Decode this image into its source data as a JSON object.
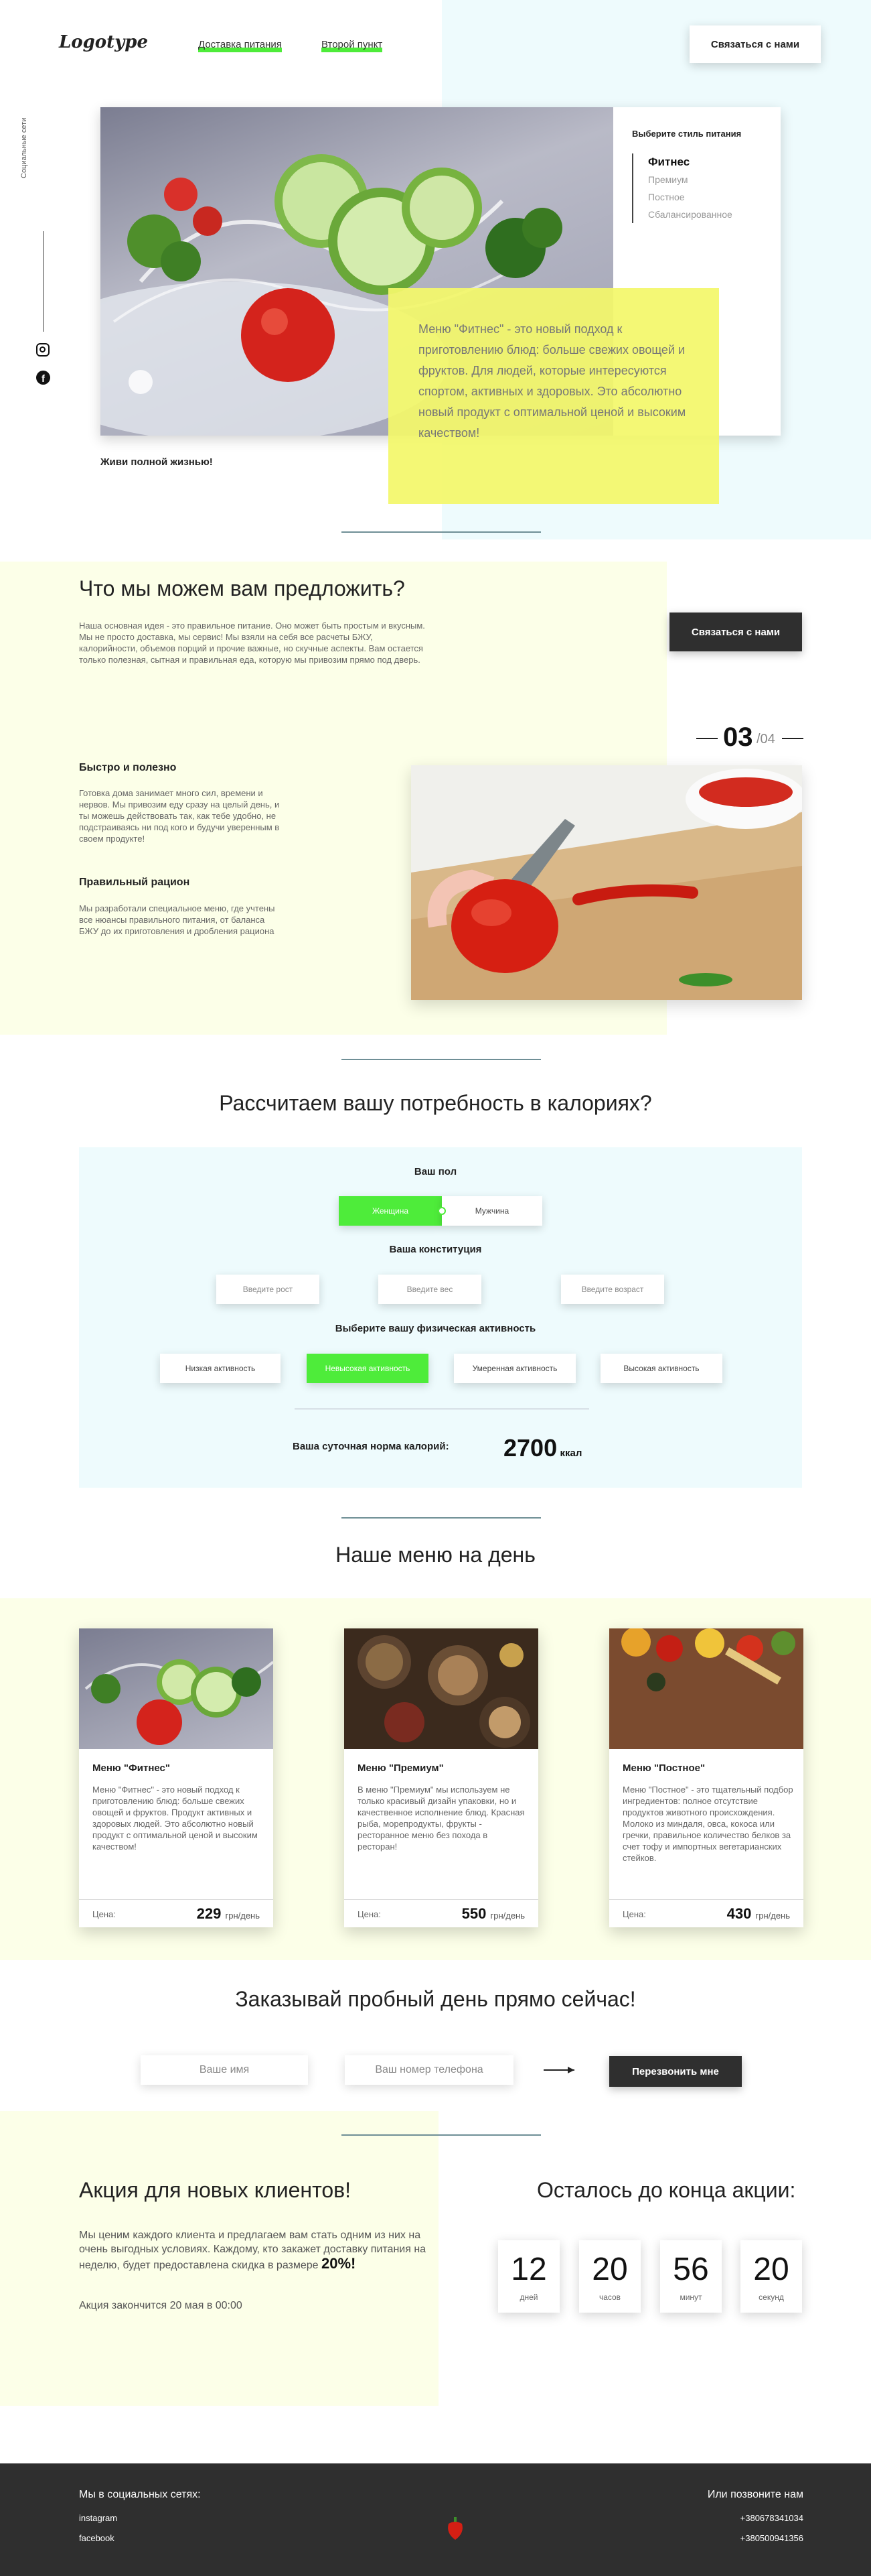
{
  "header": {
    "logo": "Logotype",
    "nav": [
      "Доставка питания",
      "Второй пункт"
    ],
    "contact_button": "Связаться с нами",
    "social_label": "Социальные сети"
  },
  "hero": {
    "style_title": "Выберите стиль питания",
    "styles": [
      "Фитнес",
      "Премиум",
      "Постное",
      "Сбалансированное"
    ],
    "active_style": "Фитнес",
    "description": "Меню \"Фитнес\" - это новый подход к приготовлению блюд: больше свежих овощей и фруктов. Для людей, которые интересуются спортом, активных и здоровых. Это абсолютно новый продукт с оптимальной ценой и высоким качеством!",
    "tagline": "Живи полной жизнью!"
  },
  "offer": {
    "title": "Что мы можем вам предложить?",
    "intro": "Наша основная идея - это правильное питание. Оно может быть простым и вкусным. Мы не просто доставка, мы сервис! Мы взяли на себя все расчеты БЖУ, калорийности, объемов порций и прочие важные, но скучные аспекты. Вам остается только полезная, сытная и правильная еда, которую мы привозим прямо под дверь.",
    "contact_button": "Связаться с нами",
    "slide_current": "03",
    "slide_total": "/04",
    "feature1_title": "Быстро и полезно",
    "feature1_text": "Готовка дома занимает много сил, времени и нервов. Мы привозим еду сразу на целый день, и ты можешь действовать так, как тебе удобно, не подстраиваясь ни под кого и будучи уверенным в своем продукте!",
    "feature2_title": "Правильный рацион",
    "feature2_text": "Мы разработали специальное меню, где учтены все нюансы правильного питания, от баланса БЖУ до их приготовления и дробления рациона"
  },
  "calculator": {
    "title": "Рассчитаем вашу потребность в калориях?",
    "gender_label": "Ваш пол",
    "gender_options": [
      "Женщина",
      "Мужчина"
    ],
    "gender_selected": "Женщина",
    "constitution_label": "Ваша конституция",
    "placeholders": {
      "height": "Введите рост",
      "weight": "Введите вес",
      "age": "Введите возраст"
    },
    "activity_label": "Выберите вашу физическая активность",
    "activity_options": [
      "Низкая активность",
      "Невысокая активность",
      "Умеренная активность",
      "Высокая активность"
    ],
    "activity_selected": "Невысокая активность",
    "result_label": "Ваша суточная норма калорий:",
    "result_value": "2700",
    "result_unit": "ккал"
  },
  "menu": {
    "title": "Наше меню на день",
    "cards": [
      {
        "title": "Меню \"Фитнес\"",
        "desc": "Меню \"Фитнес\" - это новый подход к приготовлению блюд: больше свежих овощей и фруктов. Продукт активных и здоровых людей. Это абсолютно новый продукт с оптимальной ценой и высоким качеством!",
        "price_label": "Цена:",
        "price": "229",
        "unit": "грн/день"
      },
      {
        "title": "Меню \"Премиум\"",
        "desc": "В меню \"Премиум\" мы используем не только красивый дизайн упаковки, но и качественное исполнение блюд. Красная рыба, морепродукты, фрукты - ресторанное меню без похода в ресторан!",
        "price_label": "Цена:",
        "price": "550",
        "unit": "грн/день"
      },
      {
        "title": "Меню \"Постное\"",
        "desc": "Меню \"Постное\" - это тщательный подбор ингредиентов: полное отсутствие продуктов животного происхождения. Молоко из миндаля, овса, кокоса или гречки, правильное количество белков за счет тофу и импортных вегетарианских стейков.",
        "price_label": "Цена:",
        "price": "430",
        "unit": "грн/день"
      }
    ]
  },
  "order": {
    "title": "Заказывай пробный день прямо сейчас!",
    "name_placeholder": "Ваше имя",
    "phone_placeholder": "Ваш номер телефона",
    "button": "Перезвонить мне"
  },
  "promo": {
    "title": "Акция для новых клиентов!",
    "text_before": "Мы ценим каждого клиента и предлагаем вам стать одним из них на очень выгодных условиях. Каждому, кто закажет доставку питания на неделю, будет предоставлена скидка в размере ",
    "discount": "20%!",
    "end_text": "Акция закончится 20 мая в 00:00",
    "timer_title": "Осталось до конца акции:",
    "timer": [
      {
        "value": "12",
        "label": "дней"
      },
      {
        "value": "20",
        "label": "часов"
      },
      {
        "value": "56",
        "label": "минут"
      },
      {
        "value": "20",
        "label": "секунд"
      }
    ]
  },
  "footer": {
    "social_title": "Мы в социальных сетях:",
    "social_links": [
      "instagram",
      "facebook"
    ],
    "call_title": "Или позвоните нам",
    "phones": [
      "+380678341034",
      "+380500941356"
    ]
  },
  "colors": {
    "accent_green": "#4eec3a",
    "yellow_overlay": "#f3f86a",
    "light_cyan": "#eefbfd",
    "light_yellow": "#fcffe8",
    "dark": "#2f2f2f"
  }
}
